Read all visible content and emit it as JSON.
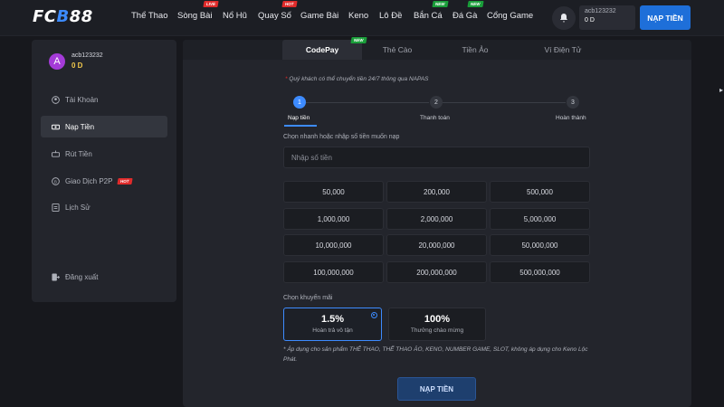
{
  "header": {
    "logo": {
      "part1": "FC",
      "part2": "B",
      "part3": "88"
    },
    "nav": [
      {
        "label": "Thể Thao",
        "tag": ""
      },
      {
        "label": "Sòng Bài",
        "tag": "LIVE"
      },
      {
        "label": "Nổ Hũ",
        "tag": ""
      },
      {
        "label": "Quay Số",
        "tag": "HOT"
      },
      {
        "label": "Game Bài",
        "tag": ""
      },
      {
        "label": "Keno",
        "tag": ""
      },
      {
        "label": "Lô Đề",
        "tag": ""
      },
      {
        "label": "Bắn Cá",
        "tag": "NEW"
      },
      {
        "label": "Đá Gà",
        "tag": "NEW"
      },
      {
        "label": "Cổng Game",
        "tag": ""
      }
    ],
    "username": "acb123232",
    "balance": "0 D",
    "deposit_button": "NẠP TIỀN",
    "accent_color": "#1e6fd9"
  },
  "sidebar": {
    "avatar_letter": "A",
    "username": "acb123232",
    "balance": "0 D",
    "items": [
      {
        "label": "Tài Khoản",
        "icon": "user-icon",
        "tag": ""
      },
      {
        "label": "Nạp Tiền",
        "icon": "cash-icon",
        "tag": ""
      },
      {
        "label": "Rút Tiền",
        "icon": "withdraw-icon",
        "tag": ""
      },
      {
        "label": "Giao Dịch P2P",
        "icon": "p2p-icon",
        "tag": "HOT"
      },
      {
        "label": "Lịch Sử",
        "icon": "history-icon",
        "tag": ""
      }
    ],
    "logout": "Đăng xuất"
  },
  "main": {
    "tabs": [
      {
        "label": "CodePay",
        "tag": "NEW"
      },
      {
        "label": "Thẻ Cào",
        "tag": ""
      },
      {
        "label": "Tiền Ảo",
        "tag": ""
      },
      {
        "label": "Ví Điện Tử",
        "tag": ""
      }
    ],
    "note": "Quý khách có thể chuyển tiền 24/7 thông qua NAPAS",
    "steps": [
      {
        "num": "1",
        "label": "Nạp tiền"
      },
      {
        "num": "2",
        "label": "Thanh toán"
      },
      {
        "num": "3",
        "label": "Hoàn thành"
      }
    ],
    "amount_label": "Chọn nhanh hoặc nhập số tiền muốn nạp",
    "amount_placeholder": "Nhập số tiền",
    "amounts": [
      "50,000",
      "200,000",
      "500,000",
      "1,000,000",
      "2,000,000",
      "5,000,000",
      "10,000,000",
      "20,000,000",
      "50,000,000",
      "100,000,000",
      "200,000,000",
      "500,000,000"
    ],
    "promo_label": "Chọn khuyến mãi",
    "promos": [
      {
        "pct": "1.5%",
        "desc": "Hoàn trả vô tận"
      },
      {
        "pct": "100%",
        "desc": "Thưởng chào mừng"
      }
    ],
    "footnote": "* Áp dụng cho sản phẩm THỂ THAO, THỂ THAO ẢO, KENO, NUMBER GAME, SLOT, không áp dụng cho Keno Lộc Phát.",
    "submit": "NẠP TIỀN"
  }
}
